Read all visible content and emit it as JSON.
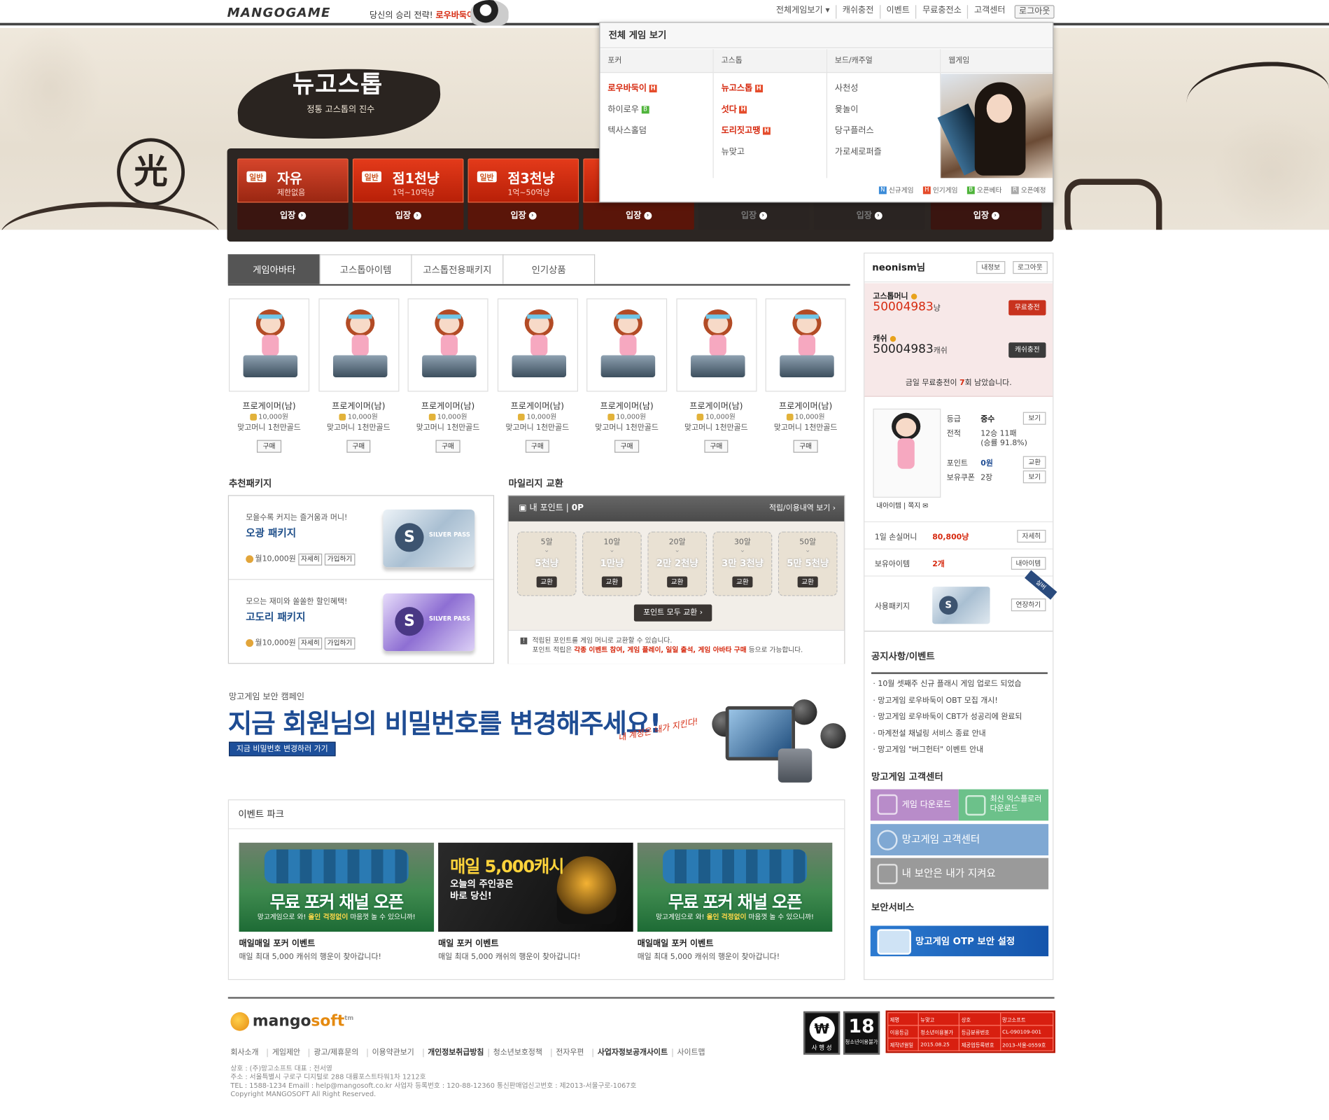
{
  "topbar": {
    "logo": "MANGOGAME",
    "slogan_prefix": "당신의 승리 전략!",
    "slogan_game": "로우바둑이",
    "nav": [
      "전체게임보기 ▾",
      "캐쉬충전",
      "이벤트",
      "무료충전소",
      "고객센터"
    ],
    "logout": "로그아웃"
  },
  "header": {
    "game_title": "뉴고스톱",
    "game_subtitle": "정통 고스톱의 진수",
    "seal_char": "光",
    "rooms": [
      {
        "badge": "일반",
        "name": "자유",
        "sub": "제한없음",
        "enter": "입장"
      },
      {
        "badge": "일반",
        "name": "점1천냥",
        "sub": "1억~10억냥",
        "enter": "입장"
      },
      {
        "badge": "일반",
        "name": "점3천냥",
        "sub": "1억~50억냥",
        "enter": "입장"
      },
      {
        "badge": "",
        "name": "",
        "sub": "",
        "enter": "입장"
      },
      {
        "badge": "",
        "name": "",
        "sub": "",
        "enter": "입장"
      },
      {
        "badge": "",
        "name": "",
        "sub": "",
        "enter": "입장"
      },
      {
        "badge": "",
        "name": "",
        "sub": "",
        "enter": "입장"
      }
    ]
  },
  "dropdown": {
    "title": "전체 게임 보기",
    "columns": [
      {
        "header": "포커",
        "items": [
          {
            "label": "로우바둑이",
            "tag": "H",
            "hot": true
          },
          {
            "label": "하이로우",
            "tag": "B",
            "hot": false
          },
          {
            "label": "텍사스홀덤",
            "tag": "",
            "hot": false
          }
        ]
      },
      {
        "header": "고스톱",
        "items": [
          {
            "label": "뉴고스톱",
            "tag": "H",
            "hot": true
          },
          {
            "label": "섯다",
            "tag": "H",
            "hot": true
          },
          {
            "label": "도리짓고땡",
            "tag": "H",
            "hot": true
          },
          {
            "label": "뉴맞고",
            "tag": "",
            "hot": false
          }
        ]
      },
      {
        "header": "보드/캐주얼",
        "items": [
          {
            "label": "사천성",
            "tag": "",
            "hot": false
          },
          {
            "label": "윷놀이",
            "tag": "",
            "hot": false
          },
          {
            "label": "당구플러스",
            "tag": "",
            "hot": false
          },
          {
            "label": "가로세로퍼즐",
            "tag": "",
            "hot": false
          }
        ]
      },
      {
        "header": "웹게임",
        "items": []
      }
    ],
    "legend": [
      {
        "tag": "N",
        "label": "신규게임"
      },
      {
        "tag": "H",
        "label": "인기게임"
      },
      {
        "tag": "B",
        "label": "오픈베타"
      },
      {
        "tag": "R",
        "label": "오픈예정"
      }
    ]
  },
  "shop": {
    "tabs": [
      "게임아바타",
      "고스톱아이템",
      "고스톱전용패키지",
      "인기상품"
    ],
    "items": [
      {
        "name": "프로게이머(남)",
        "price": "10,000원",
        "bonus": "맞고머니 1천만골드",
        "buy": "구매"
      },
      {
        "name": "프로게이머(남)",
        "price": "10,000원",
        "bonus": "맞고머니 1천만골드",
        "buy": "구매"
      },
      {
        "name": "프로게이머(남)",
        "price": "10,000원",
        "bonus": "맞고머니 1천만골드",
        "buy": "구매"
      },
      {
        "name": "프로게이머(남)",
        "price": "10,000원",
        "bonus": "맞고머니 1천만골드",
        "buy": "구매"
      },
      {
        "name": "프로게이머(남)",
        "price": "10,000원",
        "bonus": "맞고머니 1천만골드",
        "buy": "구매"
      },
      {
        "name": "프로게이머(남)",
        "price": "10,000원",
        "bonus": "맞고머니 1천만골드",
        "buy": "구매"
      },
      {
        "name": "프로게이머(남)",
        "price": "10,000원",
        "bonus": "맞고머니 1천만골드",
        "buy": "구매"
      }
    ]
  },
  "packages": {
    "title": "추천패키지",
    "items": [
      {
        "tagline": "모을수록 커지는 즐거움과 머니!",
        "name": "오광 패키지",
        "price": "월10,000원",
        "detail": "자세히",
        "join": "가입하기",
        "card_text": "SILVER PASS"
      },
      {
        "tagline": "모으는 재미와 쏠쏠한 할인혜택!",
        "name": "고도리 패키지",
        "price": "월10,000원",
        "detail": "자세히",
        "join": "가입하기",
        "card_text": "SILVER PASS"
      }
    ]
  },
  "mileage": {
    "title": "마일리지 교환",
    "my_point_label": "내 포인트",
    "my_point_value": "0P",
    "history_link": "적립/이용내역 보기 ›",
    "exchanges": [
      {
        "point": "5알",
        "value": "5천냥",
        "btn": "교환"
      },
      {
        "point": "10알",
        "value": "1만냥",
        "btn": "교환"
      },
      {
        "point": "20알",
        "value": "2만 2천냥",
        "btn": "교환"
      },
      {
        "point": "30알",
        "value": "3만 3천냥",
        "btn": "교환"
      },
      {
        "point": "50알",
        "value": "5만 5천냥",
        "btn": "교환"
      }
    ],
    "exchange_all": "포인트 모두 교환 ›",
    "note1": "적립된 포인트를 게임 머니로 교환할 수 있습니다.",
    "note2_prefix": "포인트 적립은",
    "note2_highlight": "각종 이벤트 참여, 게임 플레이, 일일 출석, 게임 아바타 구매",
    "note2_suffix": "등으로 가능합니다."
  },
  "campaign": {
    "small": "망고게임 보안 캠페인",
    "big": "지금 회원님의 비밀번호를 변경해주세요!",
    "button": "지금 비밀번호 변경하러 가기",
    "hand": "내 계정은 내가 지킨다!"
  },
  "events": {
    "title": "이벤트 파크",
    "items": [
      {
        "kind": "poker",
        "img_big": "무료 포커 채널 오픈",
        "img_small_prefix": "망고게임으로 와!",
        "img_small_highlight": "올인 걱정없이",
        "img_small_suffix": "마음껏 놀 수 있으니까!",
        "title": "매일매일 포커 이벤트",
        "desc": "매일 최대 5,000 캐쉬의 행운이 찾아갑니다!"
      },
      {
        "kind": "spade",
        "img_big": "매일 5,000캐시",
        "img_small_prefix": "오늘의 주인공은",
        "img_small_highlight": "",
        "img_small_suffix": "바로 당신!",
        "title": "매일 포커 이벤트",
        "desc": "매일 최대 5,000 캐쉬의 행운이 찾아갑니다!"
      },
      {
        "kind": "poker",
        "img_big": "무료 포커 채널 오픈",
        "img_small_prefix": "망고게임으로 와!",
        "img_small_highlight": "올인 걱정없이",
        "img_small_suffix": "마음껏 놀 수 있으니까!",
        "title": "매일매일 포커 이벤트",
        "desc": "매일 최대 5,000 캐쉬의 행운이 찾아갑니다!"
      }
    ]
  },
  "user": {
    "name": "neonism님",
    "myinfo": "내정보",
    "logout": "로그아웃",
    "gostop_money_label": "고스톱머니",
    "gostop_money": "50004983",
    "gostop_unit": "냥",
    "free_charge": "무료충전",
    "cash_label": "캐쉬",
    "cash": "50004983",
    "cash_unit": "캐쉬",
    "cash_charge": "캐쉬충전",
    "note_prefix": "금일 무료충전이",
    "note_count": "7",
    "note_suffix": "회 남았습니다.",
    "grade_label": "등급",
    "grade": "중수",
    "record_label": "전적",
    "record": "12승 11패",
    "rate": "(승률 91.8%)",
    "point_label": "포인트",
    "point": "0원",
    "coupon_label": "보유쿠폰",
    "coupon": "2장",
    "view": "보기",
    "exchange": "교환",
    "my_item": "내아이템",
    "memo": "쪽지",
    "loss_label": "1일 손실머니",
    "loss": "80,800냥",
    "detail": "자세히",
    "items_label": "보유아이템",
    "items_count": "2개",
    "my_items_btn": "내아이템",
    "pkg_label": "사용패키지",
    "pkg_ribbon": "실버",
    "extend": "연장하기"
  },
  "notice": {
    "title": "공지사항/이벤트",
    "items": [
      "10월 셋째주 신규 플래시 게임 업로드 되었습",
      "망고게임 로우바둑이 OBT 모집 개시!",
      "망고게임 로우바둑이 CBT가 성공리에 완료되",
      "마계전설 채널링 서비스 종료 안내",
      "망고게임 \"버그헌터\" 이벤트 안내"
    ]
  },
  "support": {
    "title": "망고게임 고객센터",
    "download": "게임 다운로드",
    "explorer": "최신 익스플로러 다운로드",
    "center": "망고게임 고객센터",
    "security": "내 보안은 내가 지켜요",
    "sec_title": "보안서비스",
    "otp": "망고게임 OTP 보안 설정"
  },
  "footer": {
    "logo_a": "mango",
    "logo_b": "soft",
    "tm": "tm",
    "links": [
      "회사소개",
      "게임제안",
      "광고/제휴문의",
      "이용약관보기",
      "개인정보취급방침",
      "청소년보호정책",
      "전자우편",
      "사업자정보공개사이트",
      "사이트맵"
    ],
    "info1": "상호 : (주)망고소프트 대표 : 전서영",
    "info2": "주소 : 서울특별시 구로구 디지털로 288 대륭포스트타워1차 1212호",
    "info3": "TEL : 1588-1234 Emaill : help@mangosoft.co.kr 사업자 등록번호 : 120-88-12360 통신판매업신고번호 : 제2013-서울구로-1067호",
    "info4": "Copyright MANGOSOFT All Right Reserved.",
    "rating1_label": "사 행 성",
    "rating2_num": "18",
    "rating2_label": "청소년이용불가",
    "rating_table": [
      [
        "제명",
        "뉴맞고",
        "상호",
        "망고소프트"
      ],
      [
        "이용등급",
        "청소년이용불가",
        "등급분류번호",
        "CL-090109-001"
      ],
      [
        "제작년월일",
        "2015.08.25",
        "제공업등록번호",
        "2013-서울-0559호"
      ]
    ]
  },
  "colors": {
    "brand_red": "#d62a10",
    "room_red": "#e33a1a",
    "campaign_blue": "#1e4c93",
    "money_bg": "#f7e8e8"
  }
}
